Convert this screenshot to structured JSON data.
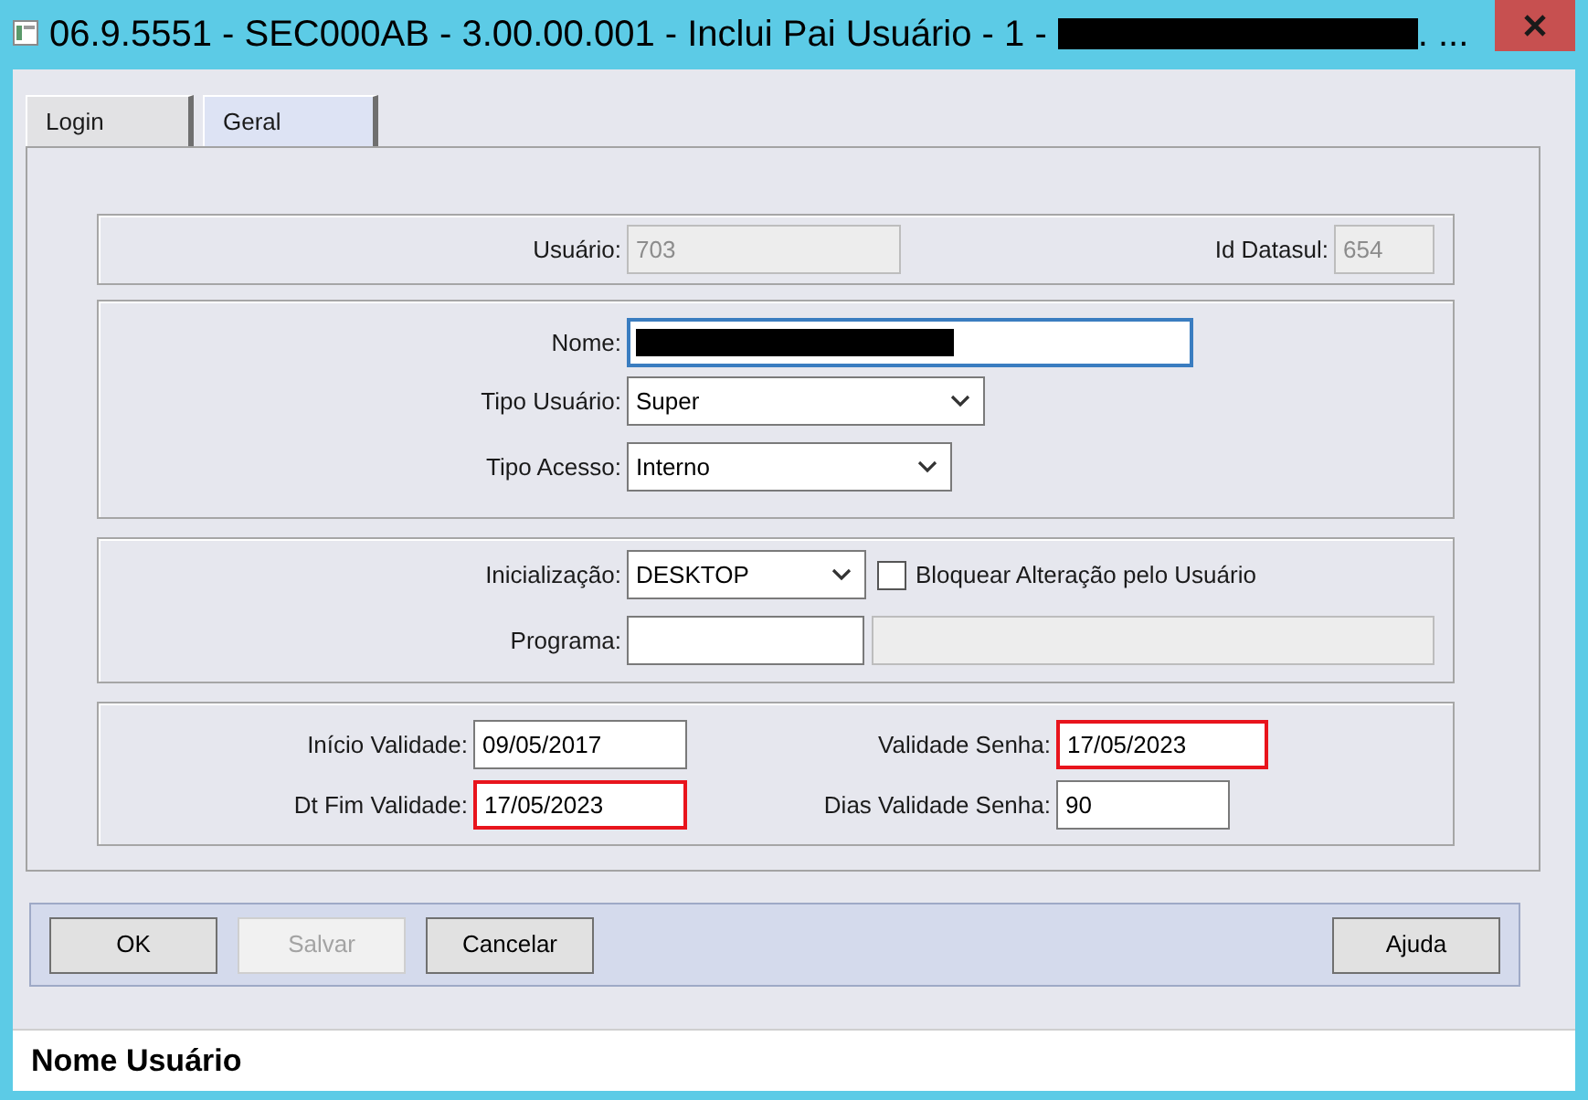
{
  "window": {
    "title": "06.9.5551 - SEC000AB - 3.00.00.001 - Inclui Pai Usuário - 1 -",
    "title_redacted": true,
    "title_tail": ". ..."
  },
  "tabs": [
    {
      "label": "Login",
      "selected": false
    },
    {
      "label": "Geral",
      "selected": true
    }
  ],
  "groups": [
    {
      "fields": [
        {
          "kind": "text",
          "label": "Usuário:",
          "value": "703",
          "disabled": true,
          "focused": false,
          "highlighted": false,
          "redacted": false
        },
        {
          "kind": "text",
          "label": "Id Datasul:",
          "value": "654",
          "disabled": true,
          "focused": false,
          "highlighted": false,
          "redacted": false
        }
      ]
    },
    {
      "fields": [
        {
          "kind": "text",
          "label": "Nome:",
          "disabled": false,
          "focused": true,
          "highlighted": false,
          "redacted": true
        },
        {
          "kind": "select",
          "label": "Tipo Usuário:",
          "value": "Super"
        },
        {
          "kind": "select",
          "label": "Tipo Acesso:",
          "value": "Interno"
        }
      ]
    },
    {
      "fields": [
        {
          "kind": "select",
          "label": "Inicialização:",
          "value": "DESKTOP"
        },
        {
          "kind": "checkbox",
          "label": "Bloquear Alteração pelo Usuário",
          "checked": false
        },
        {
          "kind": "text",
          "label": "Programa:",
          "disabled": false,
          "focused": false,
          "highlighted": false,
          "redacted": false
        },
        {
          "kind": "text",
          "disabled": true,
          "focused": false,
          "highlighted": false,
          "redacted": false
        }
      ]
    },
    {
      "fields": [
        {
          "kind": "text",
          "label": "Início Validade:",
          "value": "09/05/2017",
          "disabled": false,
          "focused": false,
          "highlighted": false,
          "redacted": false
        },
        {
          "kind": "text",
          "label": "Validade Senha:",
          "value": "17/05/2023",
          "disabled": false,
          "focused": false,
          "highlighted": true,
          "redacted": false
        },
        {
          "kind": "text",
          "label": "Dt Fim Validade:",
          "value": "17/05/2023",
          "disabled": false,
          "focused": false,
          "highlighted": true,
          "redacted": false
        },
        {
          "kind": "text",
          "label": "Dias Validade Senha:",
          "value": "90",
          "disabled": false,
          "focused": false,
          "highlighted": false,
          "redacted": false
        }
      ]
    }
  ],
  "buttons": [
    {
      "label": "OK",
      "disabled": false
    },
    {
      "label": "Salvar",
      "disabled": true
    },
    {
      "label": "Cancelar",
      "disabled": false
    }
  ],
  "right_buttons": [
    {
      "label": "Ajuda",
      "disabled": false
    }
  ],
  "status_bar": {
    "text": "Nome Usuário"
  }
}
